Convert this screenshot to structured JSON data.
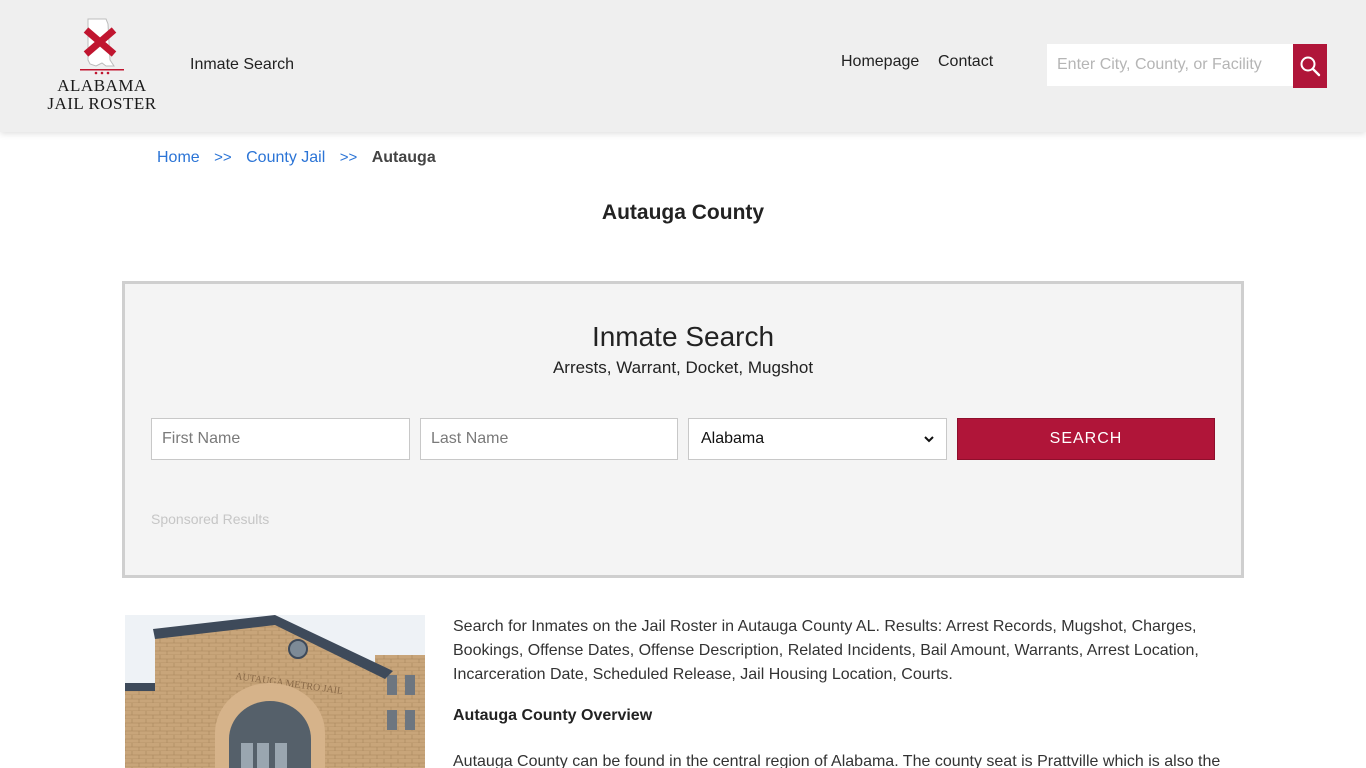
{
  "header": {
    "logo_line1": "ALABAMA",
    "logo_line2": "JAIL ROSTER",
    "nav_inmate_search": "Inmate Search",
    "nav_homepage": "Homepage",
    "nav_contact": "Contact",
    "search_placeholder": "Enter City, County, or Facility",
    "search_icon": "magnifier-icon",
    "accent_color": "#b01539"
  },
  "breadcrumb": {
    "home": "Home",
    "separator": ">>",
    "county_jail": "County Jail",
    "current": "Autauga"
  },
  "page_title": "Autauga County",
  "search_panel": {
    "title": "Inmate Search",
    "subtitle": "Arrests, Warrant, Docket, Mugshot",
    "first_name_placeholder": "First Name",
    "last_name_placeholder": "Last Name",
    "state_selected": "Alabama",
    "search_button": "SEARCH",
    "sponsored": "Sponsored Results"
  },
  "content": {
    "intro": "Search for Inmates on the Jail Roster in Autauga County AL. Results: Arrest Records, Mugshot, Charges, Bookings, Offense Dates, Offense Description, Related Incidents, Bail Amount, Warrants, Arrest Location, Incarceration Date, Scheduled Release, Jail Housing Location, Courts.",
    "overview_heading": "Autauga County Overview",
    "overview_text": "Autauga County can be found in the central region of Alabama. The county seat is Prattville which is also the",
    "photo_sign": "AUTAUGA METRO JAIL"
  }
}
